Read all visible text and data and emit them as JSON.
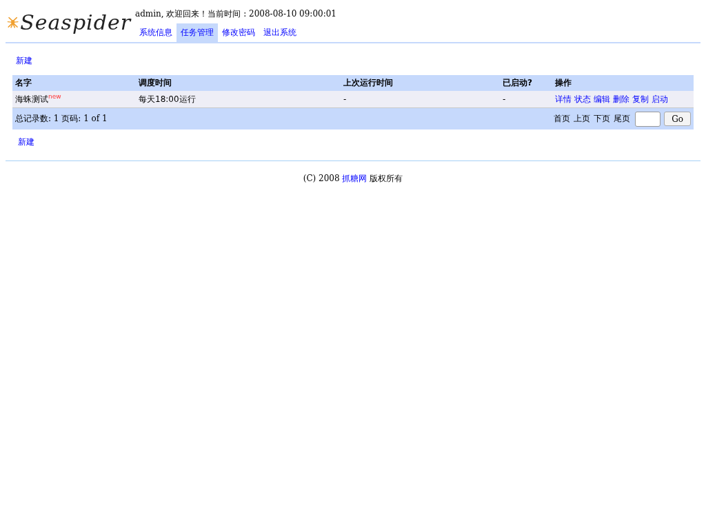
{
  "logo": {
    "text": "Seaspider"
  },
  "greeting": "admin, 欢迎回来！当前时间 : 2008-08-10 09:00:01",
  "nav": [
    {
      "label": "系统信息",
      "selected": false
    },
    {
      "label": "任务管理",
      "selected": true
    },
    {
      "label": "修改密码",
      "selected": false
    },
    {
      "label": "退出系统",
      "selected": false
    }
  ],
  "top_link": "新建",
  "table": {
    "columns": [
      "名字",
      "调度时间",
      "上次运行时间",
      "已启动?",
      "操作"
    ],
    "rows": [
      {
        "name": "海蛛测试$^{new}$",
        "schedule": "每天18:00运行",
        "last_run": "-",
        "started": "-",
        "actions": [
          "详情",
          "状态",
          "编辑",
          "删除",
          "复制",
          "启动"
        ]
      }
    ],
    "summary": "总记录数: 1 页码: 1 of 1",
    "pager": [
      "首页",
      "上页",
      "下页",
      "尾页"
    ],
    "go_button": "Go"
  },
  "bottom_link": "新建",
  "footer": {
    "before": "(C) 2008 ",
    "link": "抓糖网",
    "after": " 版权所有"
  }
}
